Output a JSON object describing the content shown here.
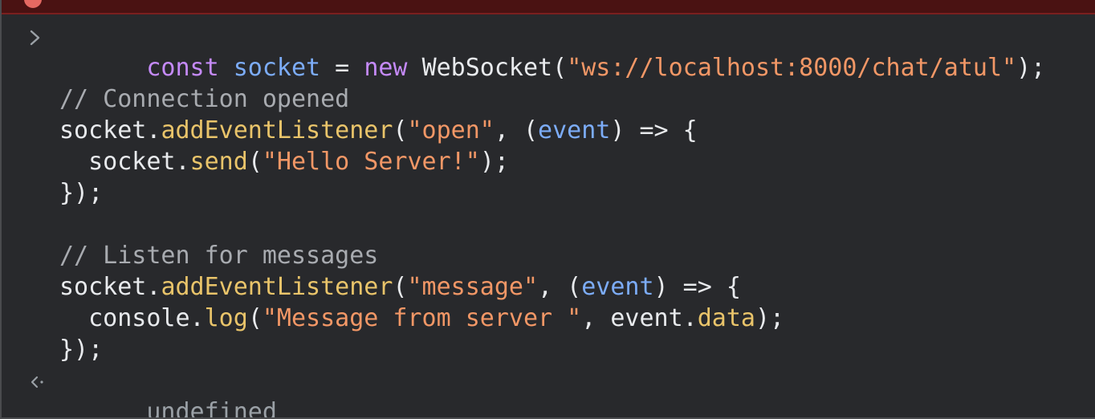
{
  "error_banner": {
    "icon": "error-circle-icon"
  },
  "input": {
    "prompt_icon": "chevron-right-icon",
    "line1": {
      "kw_const": "const",
      "sp1": " ",
      "socket": "socket",
      "eq": " = ",
      "kw_new": "new",
      "sp2": " ",
      "ctor": "WebSocket(",
      "url": "\"ws://localhost:8000/chat/atul\"",
      "end": ");"
    },
    "line3": {
      "comment": "// Connection opened"
    },
    "line4": {
      "obj": "socket.",
      "method": "addEventListener",
      "open": "(",
      "arg": "\"open\"",
      "sep": ", (",
      "param": "event",
      "arrow": ") => {"
    },
    "line5": {
      "indent": "  ",
      "obj": "socket.",
      "method": "send",
      "open": "(",
      "arg": "\"Hello Server!\"",
      "end": ");"
    },
    "line6": {
      "text": "});"
    },
    "line8": {
      "comment": "// Listen for messages"
    },
    "line9": {
      "obj": "socket.",
      "method": "addEventListener",
      "open": "(",
      "arg": "\"message\"",
      "sep": ", (",
      "param": "event",
      "arrow": ") => {"
    },
    "line10": {
      "indent": "  ",
      "obj": "console.",
      "method": "log",
      "open": "(",
      "arg": "\"Message from server \"",
      "sep": ", event.",
      "prop": "data",
      "end": ");"
    },
    "line11": {
      "text": "});"
    }
  },
  "output": {
    "result_icon": "chevron-left-icon",
    "value": "undefined"
  },
  "colors": {
    "background": "#28292c",
    "keyword": "#c58af9",
    "variable": "#7cacf8",
    "function": "#e9c46a",
    "string": "#f29766",
    "comment": "#a8abb0",
    "text": "#e8eaed",
    "muted": "#9aa0a6"
  }
}
